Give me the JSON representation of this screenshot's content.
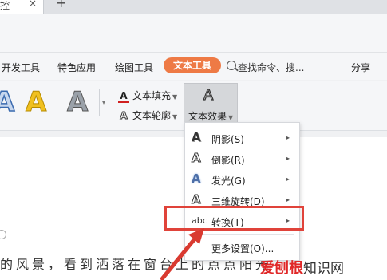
{
  "tabbar": {
    "tab_label": "控",
    "close": "×",
    "new_tab": "+"
  },
  "menu": {
    "items": [
      "开发工具",
      "特色应用",
      "绘图工具"
    ],
    "active": "文本工具",
    "search": "查找命令、搜...",
    "share": "分享"
  },
  "ribbon": {
    "art_letter": "A",
    "fill_label": "文本填充",
    "outline_label": "文本轮廓",
    "effect_label": "文本效果",
    "accent": "#ee7a45"
  },
  "dropdown": {
    "items": [
      {
        "label": "阴影(S)",
        "icon": "shadow-icon",
        "arrow": "▸"
      },
      {
        "label": "倒影(R)",
        "icon": "reflection-icon",
        "arrow": "▸"
      },
      {
        "label": "发光(G)",
        "icon": "glow-icon",
        "arrow": "▸"
      },
      {
        "label": "三维旋转(D)",
        "icon": "3d-rotate-icon",
        "arrow": "▸"
      },
      {
        "label": "转换(T)",
        "icon": "transform-icon",
        "arrow": "▸"
      },
      {
        "label": "更多设置(O)...",
        "icon": "",
        "arrow": ""
      }
    ],
    "transform_icon_text": "abc"
  },
  "document": {
    "text": "的风景，看到洒落在窗台上的点点阳光"
  },
  "watermark": {
    "main": "爱刨根",
    "sub": "知识网"
  },
  "colors": {
    "highlight": "#e0433a",
    "arrow": "#d93a30"
  }
}
